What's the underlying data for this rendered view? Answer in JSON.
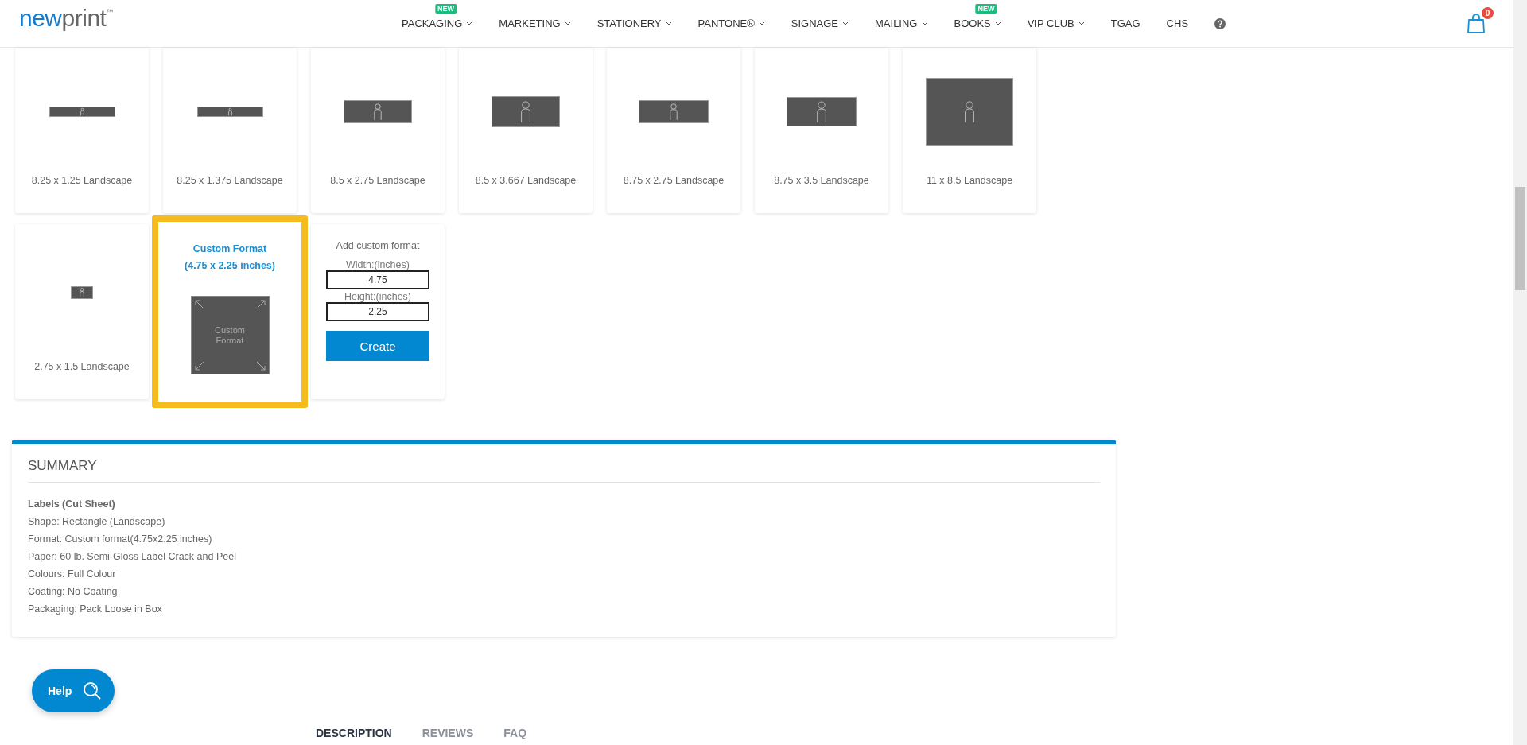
{
  "header": {
    "logo": {
      "first": "new",
      "second": "print",
      "mark": "™"
    },
    "nav": [
      {
        "label": "PACKAGING",
        "has_menu": true,
        "badge": "NEW"
      },
      {
        "label": "MARKETING",
        "has_menu": true
      },
      {
        "label": "STATIONERY",
        "has_menu": true
      },
      {
        "label": "PANTONE®",
        "has_menu": true
      },
      {
        "label": "SIGNAGE",
        "has_menu": true
      },
      {
        "label": "MAILING",
        "has_menu": true
      },
      {
        "label": "BOOKS",
        "has_menu": true,
        "badge": "NEW"
      },
      {
        "label": "VIP CLUB",
        "has_menu": true
      },
      {
        "label": "TGAG",
        "has_menu": false
      },
      {
        "label": "CHS",
        "has_menu": false
      }
    ],
    "cart_count": "0"
  },
  "formats": [
    {
      "kind": "preset",
      "label": "8.25 x 1.25 Landscape",
      "selected": false
    },
    {
      "kind": "preset",
      "label": "8.25 x 1.375 Landscape",
      "selected": false
    },
    {
      "kind": "preset",
      "label": "8.5 x 2.75 Landscape",
      "selected": false
    },
    {
      "kind": "preset",
      "label": "8.5 x 3.667 Landscape",
      "selected": false
    },
    {
      "kind": "preset",
      "label": "8.75 x 2.75 Landscape",
      "selected": false
    },
    {
      "kind": "preset",
      "label": "8.75 x 3.5 Landscape",
      "selected": false
    },
    {
      "kind": "preset",
      "label": "11 x 8.5 Landscape",
      "selected": false
    },
    {
      "kind": "preset",
      "label": "2.75 x 1.5 Landscape",
      "selected": false
    },
    {
      "kind": "custom",
      "title": "Custom Format",
      "subtitle": "(4.75 x 2.25 inches)",
      "image_text": "Custom Format",
      "selected": true
    }
  ],
  "custom_form": {
    "title": "Add custom format",
    "width_label": "Width:(inches)",
    "width_value": "4.75",
    "height_label": "Height:(inches)",
    "height_value": "2.25",
    "button": "Create"
  },
  "summary": {
    "heading": "SUMMARY",
    "product": "Labels (Cut Sheet)",
    "lines": [
      "Shape: Rectangle (Landscape)",
      "Format: Custom format(4.75x2.25 inches)",
      "Paper: 60 lb. Semi-Gloss Label Crack and Peel",
      "Colours: Full Colour",
      "Coating: No Coating",
      "Packaging: Pack Loose in Box"
    ]
  },
  "help": {
    "label": "Help"
  },
  "tabs": [
    {
      "label": "DESCRIPTION",
      "selected": true
    },
    {
      "label": "REVIEWS",
      "selected": false
    },
    {
      "label": "FAQ",
      "selected": false
    }
  ]
}
